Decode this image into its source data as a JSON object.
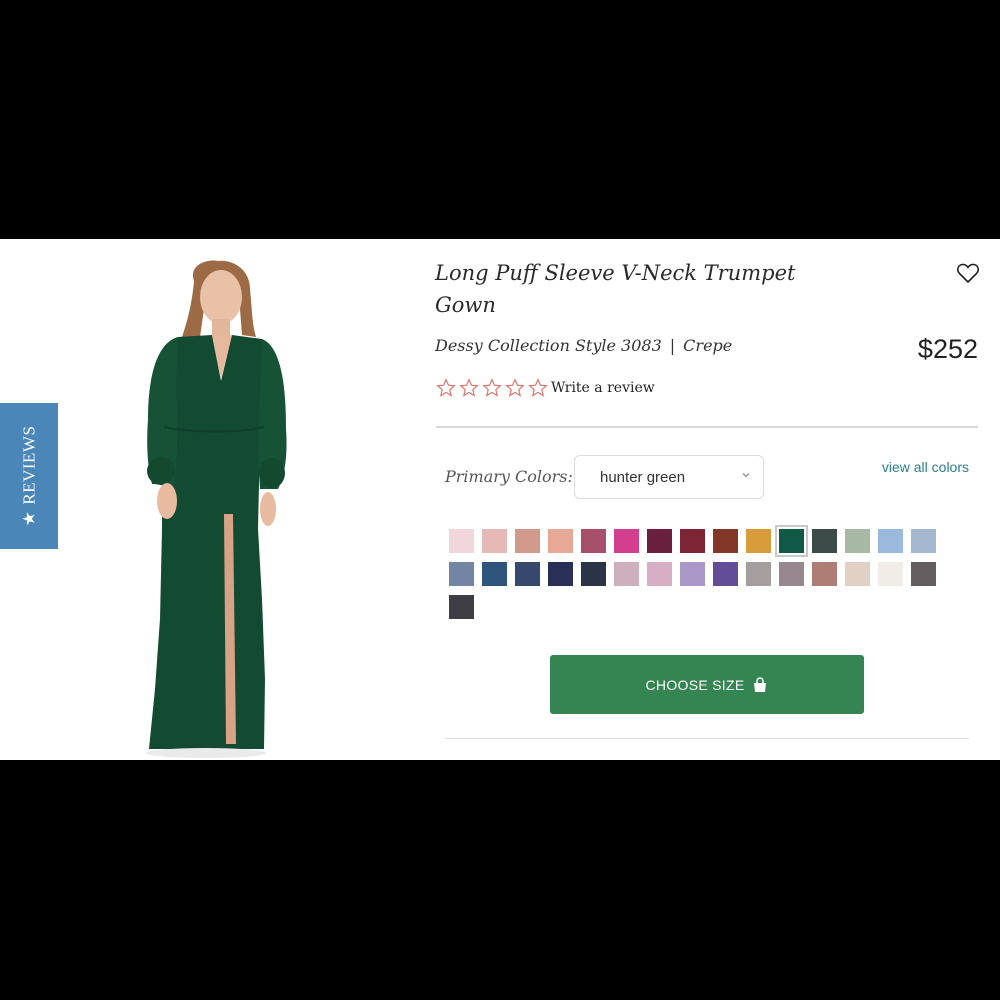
{
  "reviews_tab": {
    "label": "REVIEWS",
    "star": "★"
  },
  "product": {
    "title": "Long Puff Sleeve V-Neck Trumpet Gown",
    "collection": "Dessy Collection Style 3083",
    "fabric": "Crepe",
    "separator": "|",
    "price": "$252",
    "rating_stars": 5,
    "write_review": "Write a review",
    "image_icon": "model-in-green-gown-photo"
  },
  "colors": {
    "label": "Primary Colors:",
    "selected": "hunter green",
    "view_all": "view all colors",
    "swatches": [
      "#f1d6dc",
      "#e4b9b6",
      "#d09a8c",
      "#e6a995",
      "#a6506c",
      "#d23f8f",
      "#6b1f3e",
      "#7d2535",
      "#823628",
      "#d99c3b",
      "#105a45",
      "#3c4b48",
      "#a7b8a5",
      "#9ab9dc",
      "#a3b8cf",
      "#7285a3",
      "#2e557c",
      "#36496c",
      "#2a2f57",
      "#2b3447",
      "#cdb0bb",
      "#d8aec4",
      "#ab97c8",
      "#634c98",
      "#a59d9e",
      "#978890",
      "#ad7d76",
      "#e3d0c5",
      "#efede6",
      "#645d5f",
      "#3f3e44"
    ],
    "selected_index": 10
  },
  "cta": {
    "choose_size": "CHOOSE SIZE"
  },
  "theme": {
    "accent": "#358552",
    "link": "#2b7f8c",
    "reviews_bg": "#4a86b8",
    "star_outline": "#d9746b"
  }
}
